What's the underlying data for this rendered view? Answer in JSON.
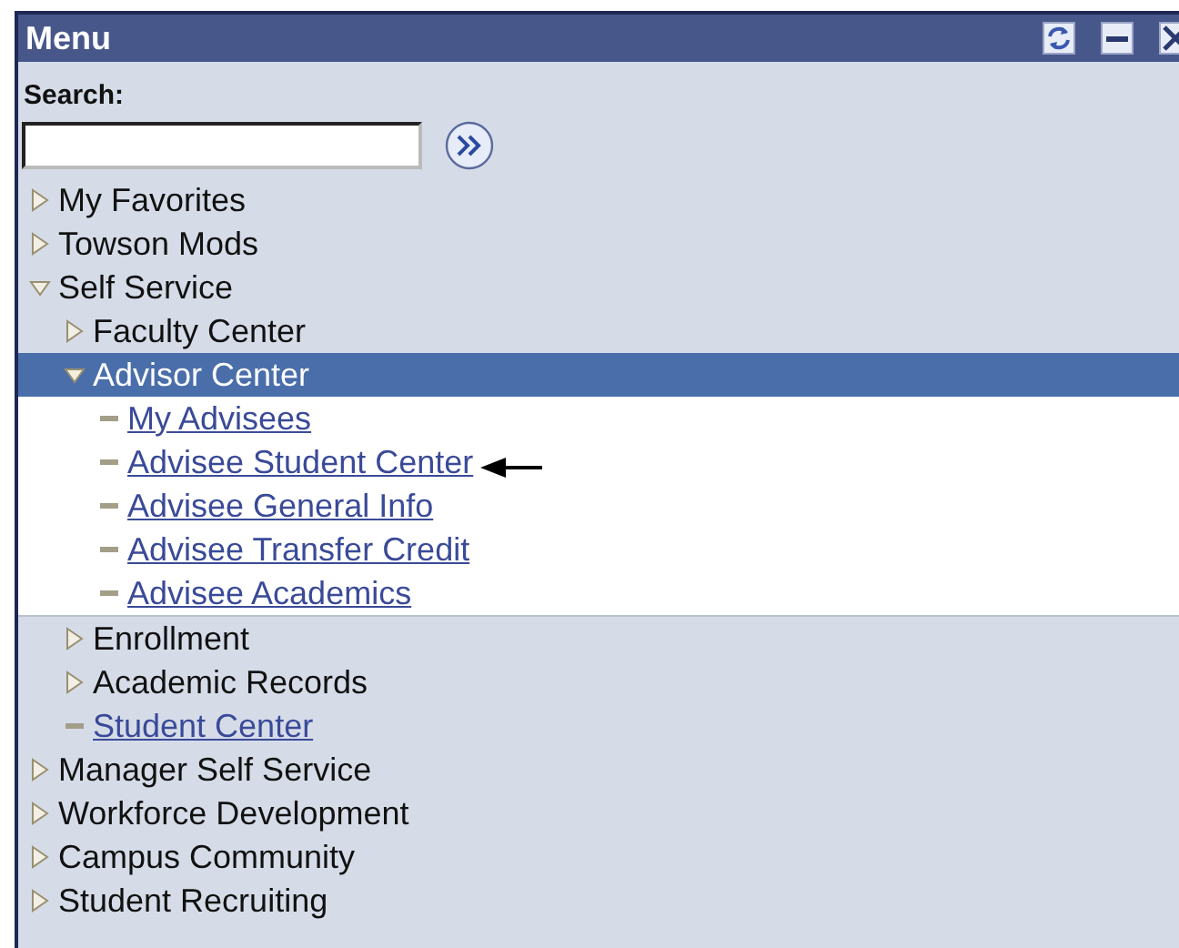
{
  "window": {
    "title": "Menu"
  },
  "search": {
    "label": "Search:"
  },
  "menu": [
    {
      "label": "My Favorites",
      "kind": "folder",
      "expanded": false,
      "selected": false
    },
    {
      "label": "Towson Mods",
      "kind": "folder",
      "expanded": false,
      "selected": false
    },
    {
      "label": "Self Service",
      "kind": "folder",
      "expanded": true,
      "selected": false,
      "children": [
        {
          "label": "Faculty Center",
          "kind": "folder",
          "expanded": false,
          "selected": false
        },
        {
          "label": "Advisor Center",
          "kind": "folder",
          "expanded": true,
          "selected": true,
          "children": [
            {
              "label": "My Advisees",
              "kind": "link",
              "selected": false
            },
            {
              "label": "Advisee Student Center",
              "kind": "link",
              "selected": false
            },
            {
              "label": "Advisee General Info",
              "kind": "link",
              "selected": false
            },
            {
              "label": "Advisee Transfer Credit",
              "kind": "link",
              "selected": false
            },
            {
              "label": "Advisee Academics",
              "kind": "link",
              "selected": false
            }
          ]
        },
        {
          "label": "Enrollment",
          "kind": "folder",
          "expanded": false,
          "selected": false
        },
        {
          "label": "Academic Records",
          "kind": "folder",
          "expanded": false,
          "selected": false
        },
        {
          "label": "Student Center",
          "kind": "link",
          "selected": false
        }
      ]
    },
    {
      "label": "Manager Self Service",
      "kind": "folder",
      "expanded": false,
      "selected": false
    },
    {
      "label": "Workforce Development",
      "kind": "folder",
      "expanded": false,
      "selected": false
    },
    {
      "label": "Campus Community",
      "kind": "folder",
      "expanded": false,
      "selected": false
    },
    {
      "label": "Student Recruiting",
      "kind": "folder",
      "expanded": false,
      "selected": false
    }
  ]
}
